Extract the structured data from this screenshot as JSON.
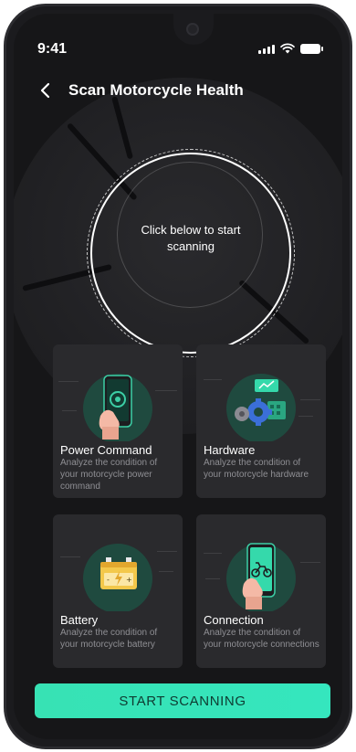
{
  "status": {
    "time": "9:41"
  },
  "header": {
    "title": "Scan Motorcycle Health"
  },
  "scanner": {
    "prompt": "Click below to start scanning"
  },
  "cards": [
    {
      "title": "Power Command",
      "description": "Analyze the condition of your motorcycle power command",
      "icon": "phone-power-icon"
    },
    {
      "title": "Hardware",
      "description": "Analyze the condition of your motorcycle hardware",
      "icon": "hardware-gears-icon"
    },
    {
      "title": "Battery",
      "description": "Analyze the condition of your motorcycle battery",
      "icon": "battery-icon"
    },
    {
      "title": "Connection",
      "description": "Analyze the condition of your motorcycle connections",
      "icon": "phone-motorcycle-icon"
    }
  ],
  "cta": {
    "label": "START SCANNING"
  },
  "colors": {
    "accent": "#35e3b6",
    "background": "#161618",
    "card": "#2a2a2d",
    "illustration_bg": "#1f4a3f"
  }
}
